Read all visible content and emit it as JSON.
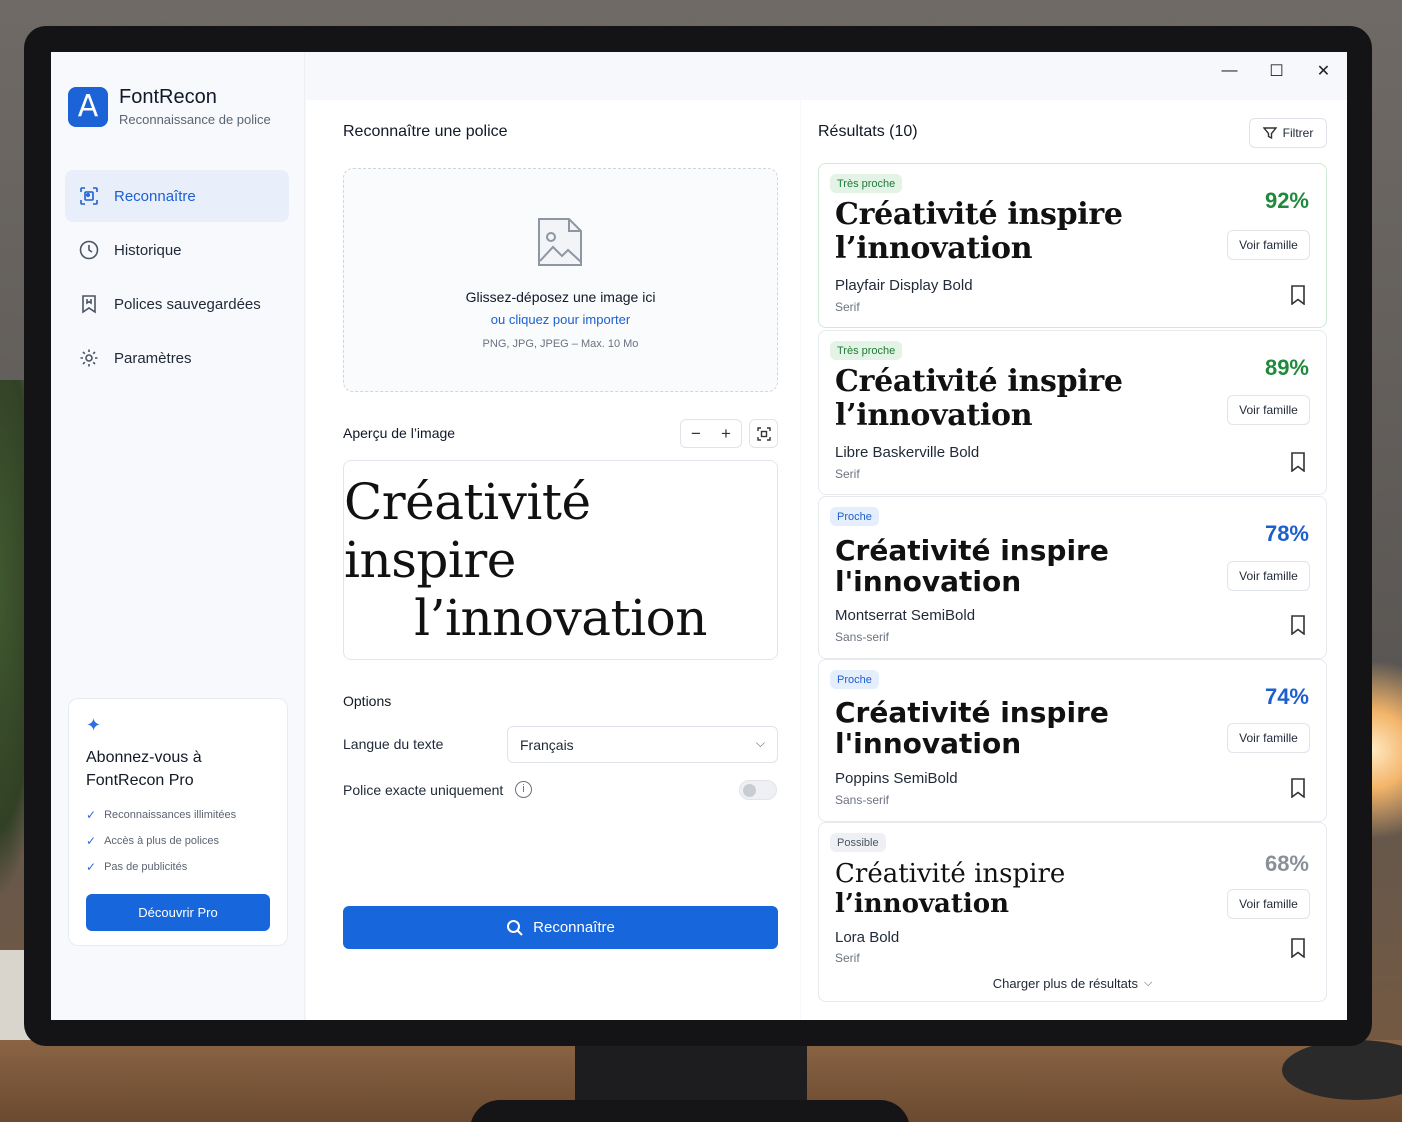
{
  "window": {
    "controls": {
      "minimize": "—",
      "maximize": "☐",
      "close": "✕"
    }
  },
  "brand": {
    "logo_letter": "A",
    "name": "FontRecon",
    "subtitle": "Reconnaissance de police"
  },
  "sidebar": {
    "items": [
      {
        "label": "Reconnaître",
        "icon": "scan-icon",
        "active": true
      },
      {
        "label": "Historique",
        "icon": "clock-icon",
        "active": false
      },
      {
        "label": "Polices sauvegardées",
        "icon": "saved-fonts-icon",
        "active": false
      },
      {
        "label": "Paramètres",
        "icon": "gear-icon",
        "active": false
      }
    ],
    "pro": {
      "icon": "sparkle-icon",
      "title_line1": "Abonnez-vous à",
      "title_line2": "FontRecon Pro",
      "features": [
        "Reconnaissances illimitées",
        "Accès à plus de polices",
        "Pas de publicités"
      ],
      "button": "Découvrir Pro"
    }
  },
  "recognize": {
    "title": "Reconnaître une police",
    "dropzone": {
      "icon": "image-icon",
      "primary": "Glissez-déposez une image ici",
      "link": "ou cliquez pour importer",
      "hint": "PNG, JPG, JPEG – Max. 10 Mo"
    },
    "preview": {
      "title": "Aperçu de l’image",
      "line1": "Créativité inspire",
      "line2": "l’innovation",
      "zoom_out": "−",
      "zoom_in": "+"
    },
    "options": {
      "title": "Options",
      "language_label": "Langue du texte",
      "language_value": "Français",
      "exact_label": "Police exacte uniquement",
      "exact_enabled": false
    },
    "button": "Reconnaître"
  },
  "results": {
    "title": "Résultats (10)",
    "filter": "Filtrer",
    "view_family": "Voir famille",
    "load_more": "Charger plus de résultats",
    "items": [
      {
        "badge": "Très proche",
        "score": "92%",
        "line1": "Créativité inspire",
        "line2": "l’innovation",
        "font": "Playfair Display Bold",
        "category": "Serif",
        "color": "#1f8a3b"
      },
      {
        "badge": "Très proche",
        "score": "89%",
        "line1": "Créativité inspire",
        "line2": "l’innovation",
        "font": "Libre Baskerville Bold",
        "category": "Serif",
        "color": "#1f8a3b"
      },
      {
        "badge": "Proche",
        "score": "78%",
        "line1": "Créativité inspire",
        "line2": "l'innovation",
        "font": "Montserrat SemiBold",
        "category": "Sans-serif",
        "color": "#1d5fd1"
      },
      {
        "badge": "Proche",
        "score": "74%",
        "line1": "Créativité inspire",
        "line2": "l'innovation",
        "font": "Poppins SemiBold",
        "category": "Sans-serif",
        "color": "#1d5fd1"
      },
      {
        "badge": "Possible",
        "score": "68%",
        "line1": "Créativité inspire",
        "line2": "l’innovation",
        "font": "Lora Bold",
        "category": "Serif",
        "color": "#8a9099"
      }
    ]
  }
}
